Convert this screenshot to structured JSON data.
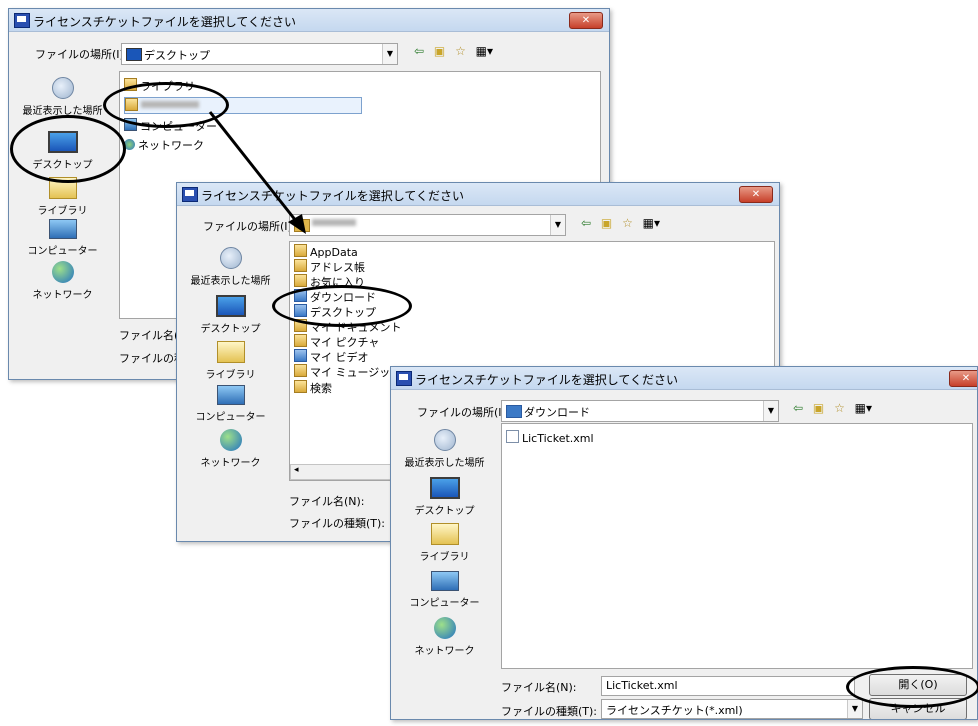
{
  "dialog_title": "ライセンスチケットファイルを選択してください",
  "close_label": "✕",
  "look_in_label": "ファイルの場所(I):",
  "filename_label": "ファイル名(N):",
  "filetype_label": "ファイルの種類(T):",
  "filename_label_short": "ファイル名(N)",
  "filetype_label_short": "ファイルの種類",
  "toolbar": {
    "back": "⇦",
    "up": "▣",
    "new_folder": "☆",
    "views": "▦▾"
  },
  "places": {
    "recent": "最近表示した場所",
    "recent_partial": "最近表示した場所",
    "desktop": "デスクトップ",
    "library": "ライブラリ",
    "computer": "コンピューター",
    "network": "ネットワーク"
  },
  "dialog1": {
    "look_in_value": "デスクトップ",
    "items": [
      "ライブラリ",
      "",
      "コンピューター",
      "ネットワーク"
    ]
  },
  "dialog2": {
    "look_in_value": "",
    "items": [
      "AppData",
      "アドレス帳",
      "お気に入り",
      "ダウンロード",
      "デスクトップ",
      "マイ ドキュメント",
      "マイ ピクチャ",
      "マイ ビデオ",
      "マイ ミュージッ",
      "検索"
    ]
  },
  "dialog3": {
    "look_in_value": "ダウンロード",
    "items": [
      "LicTicket.xml"
    ],
    "filename_value": "LicTicket.xml",
    "filetype_value": "ライセンスチケット(*.xml)",
    "open_button": "開く(O)",
    "cancel_button": "キャンセル"
  },
  "colors": {
    "annotation": "#000000",
    "selection": "#e9f2fd",
    "titlebar": "#c5d8ef",
    "close": "#c7402a"
  }
}
